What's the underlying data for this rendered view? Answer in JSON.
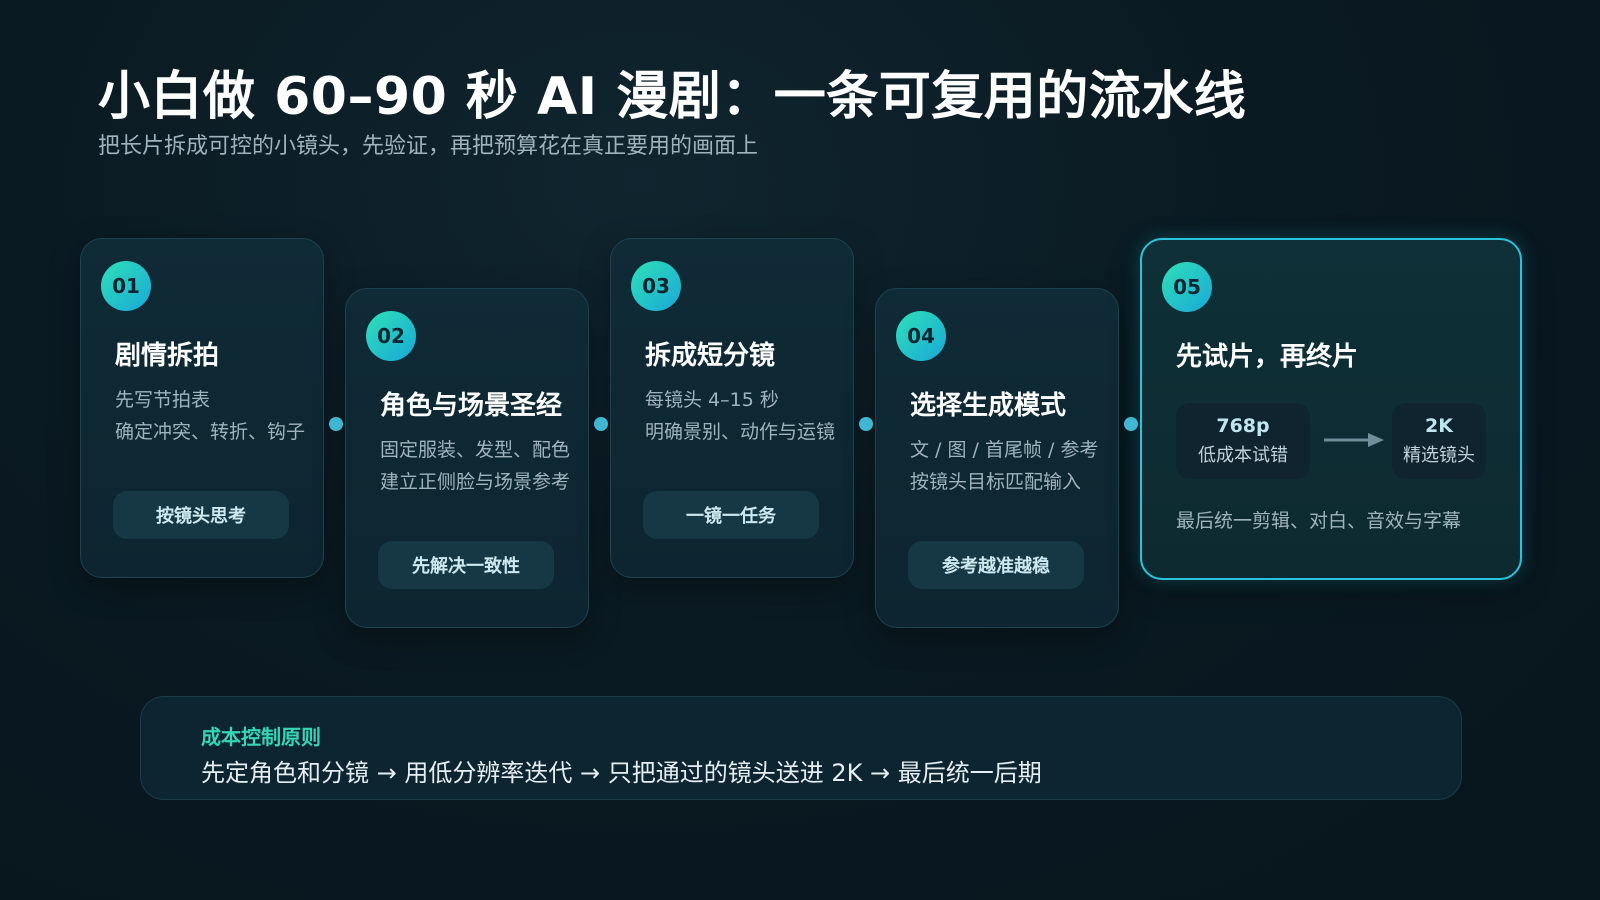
{
  "header": {
    "title": "小白做 60–90 秒 AI 漫剧：一条可复用的流水线",
    "subtitle": "把长片拆成可控的小镜头，先验证，再把预算花在真正要用的画面上"
  },
  "steps": [
    {
      "num": "01",
      "title": "剧情拆拍",
      "line1": "先写节拍表",
      "line2": "确定冲突、转折、钩子",
      "tag": "按镜头思考"
    },
    {
      "num": "02",
      "title": "角色与场景圣经",
      "line1": "固定服装、发型、配色",
      "line2": "建立正侧脸与场景参考",
      "tag": "先解决一致性"
    },
    {
      "num": "03",
      "title": "拆成短分镜",
      "line1": "每镜头 4–15 秒",
      "line2": "明确景别、动作与运镜",
      "tag": "一镜一任务"
    },
    {
      "num": "04",
      "title": "选择生成模式",
      "line1": "文 / 图 / 首尾帧 / 参考",
      "line2": "按镜头目标匹配输入",
      "tag": "参考越准越稳"
    }
  ],
  "final_step": {
    "num": "05",
    "title": "先试片，再终片",
    "trial": {
      "value": "768p",
      "label": "低成本试错"
    },
    "final": {
      "value": "2K",
      "label": "精选镜头"
    },
    "footer": "最后统一剪辑、对白、音效与字幕"
  },
  "principle": {
    "label": "成本控制原则",
    "text": "先定角色和分镜 → 用低分辨率迭代 → 只把通过的镜头送进 2K → 最后统一后期"
  },
  "colors": {
    "accent_teal": "#35d6b6",
    "accent_cyan": "#29c4dc",
    "connector": "#3fb7d2",
    "background": "#0a1a22"
  }
}
